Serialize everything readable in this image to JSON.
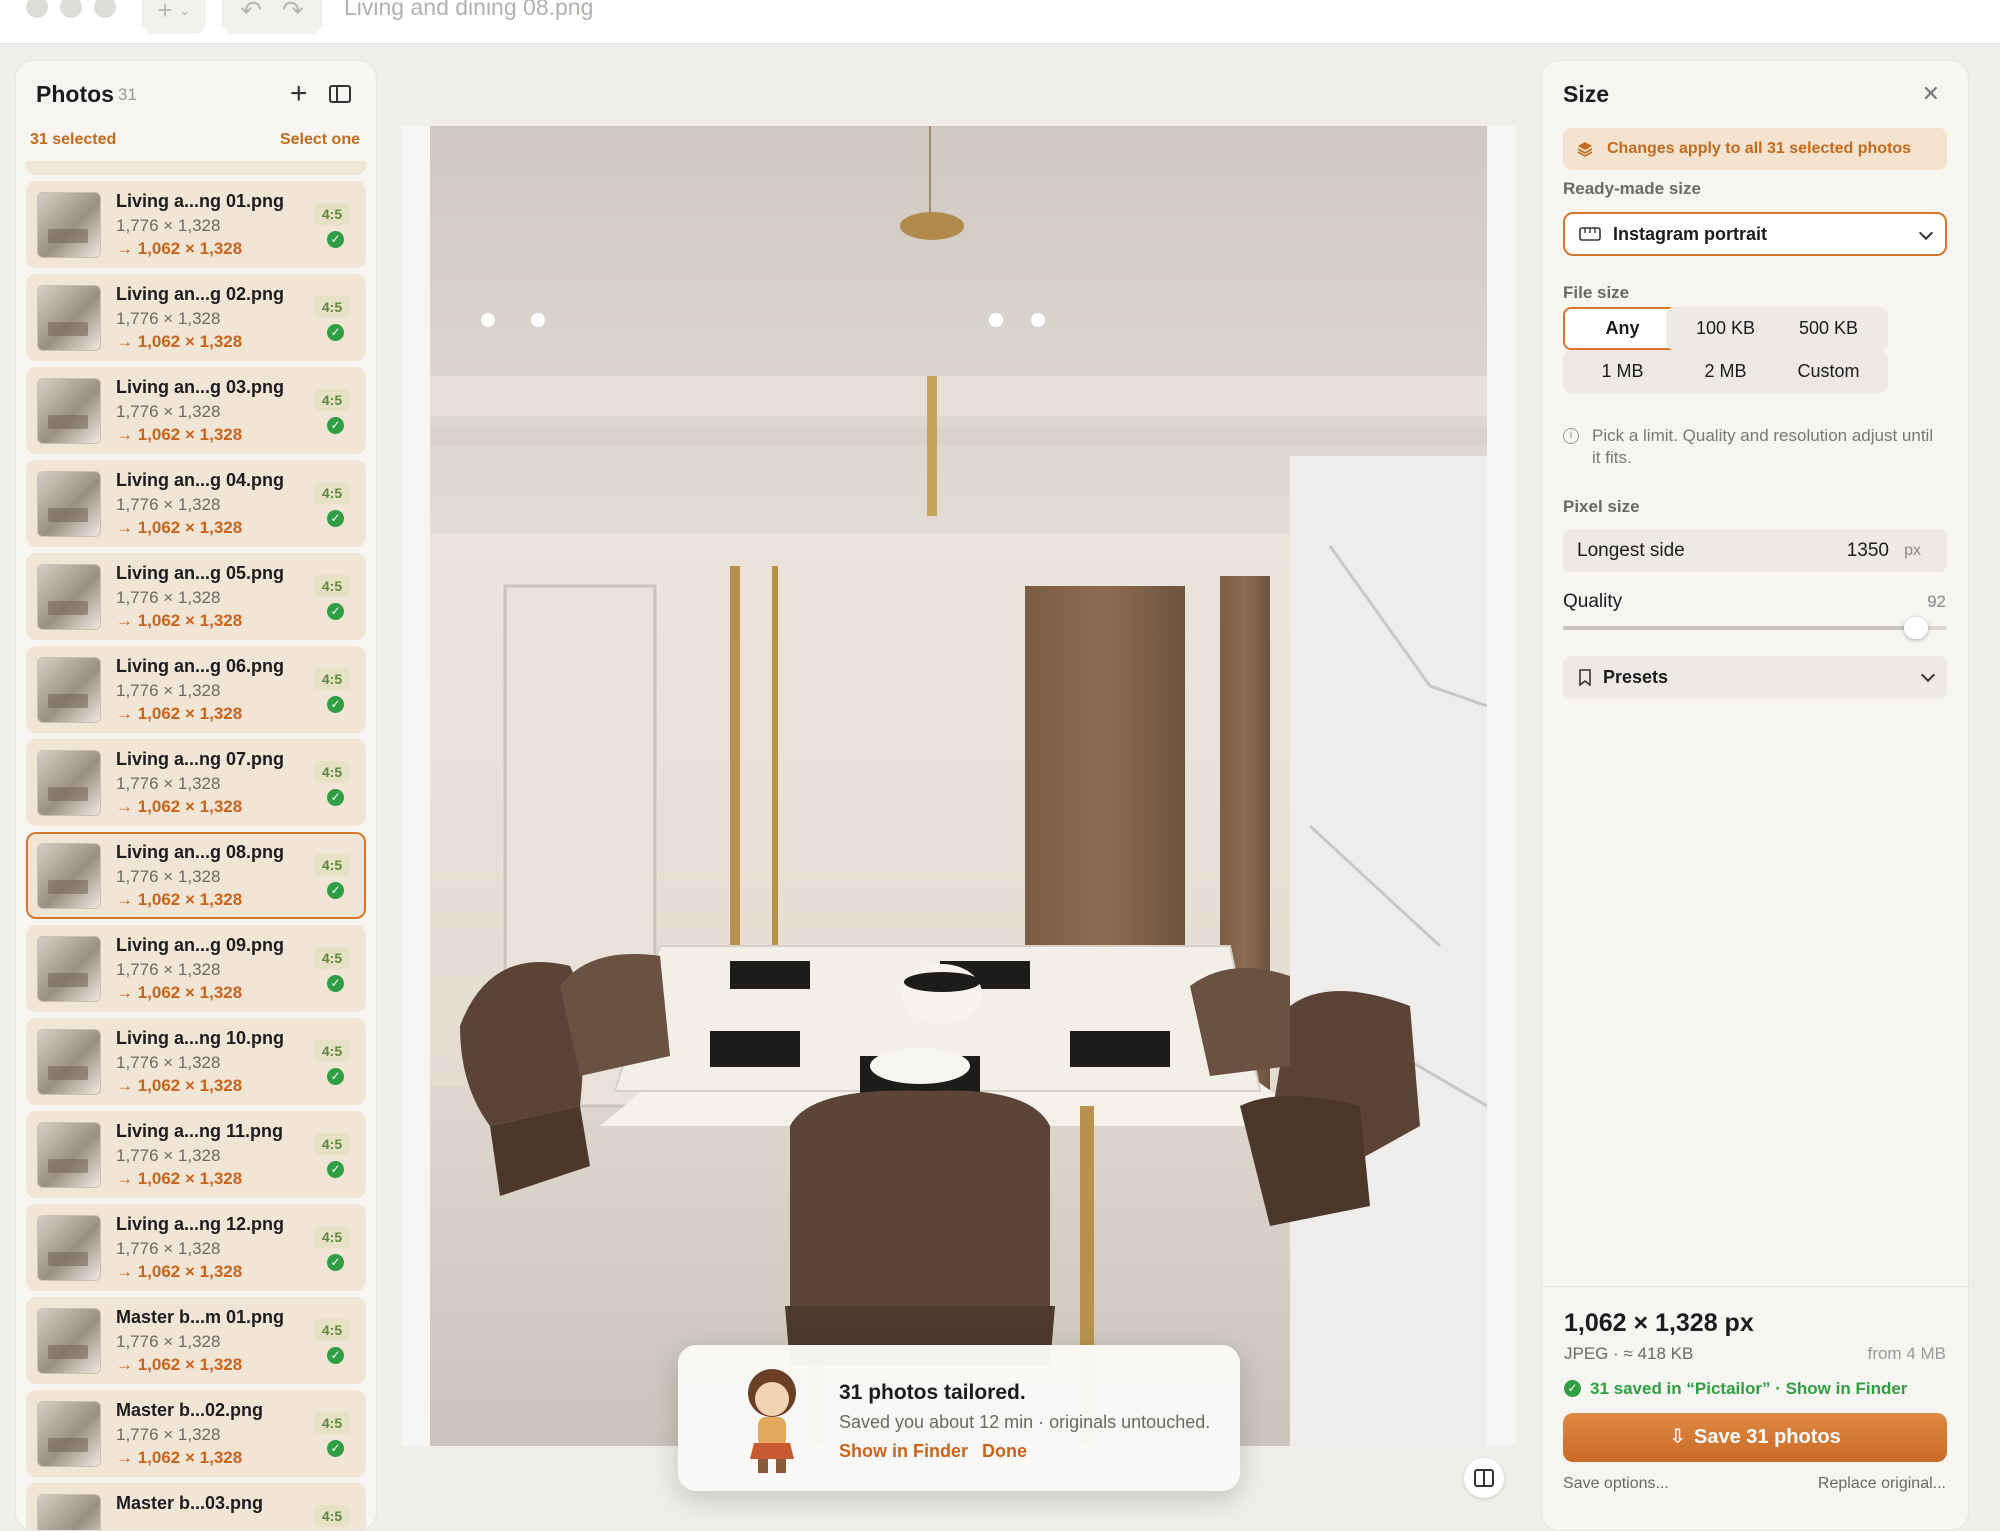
{
  "window": {
    "title": "Living and dining 08.png"
  },
  "sidebar": {
    "title": "Photos",
    "count": "31",
    "selected_text": "31 selected",
    "select_one": "Select one",
    "items": [
      {
        "name": "Living a...ng 01.png",
        "dim": "1,776 × 1,328",
        "new": "→ 1,062 × 1,328",
        "ratio": "4:5",
        "active": false
      },
      {
        "name": "Living an...g 02.png",
        "dim": "1,776 × 1,328",
        "new": "→ 1,062 × 1,328",
        "ratio": "4:5",
        "active": false
      },
      {
        "name": "Living an...g 03.png",
        "dim": "1,776 × 1,328",
        "new": "→ 1,062 × 1,328",
        "ratio": "4:5",
        "active": false
      },
      {
        "name": "Living an...g 04.png",
        "dim": "1,776 × 1,328",
        "new": "→ 1,062 × 1,328",
        "ratio": "4:5",
        "active": false
      },
      {
        "name": "Living an...g 05.png",
        "dim": "1,776 × 1,328",
        "new": "→ 1,062 × 1,328",
        "ratio": "4:5",
        "active": false
      },
      {
        "name": "Living an...g 06.png",
        "dim": "1,776 × 1,328",
        "new": "→ 1,062 × 1,328",
        "ratio": "4:5",
        "active": false
      },
      {
        "name": "Living a...ng 07.png",
        "dim": "1,776 × 1,328",
        "new": "→ 1,062 × 1,328",
        "ratio": "4:5",
        "active": false
      },
      {
        "name": "Living an...g 08.png",
        "dim": "1,776 × 1,328",
        "new": "→ 1,062 × 1,328",
        "ratio": "4:5",
        "active": true
      },
      {
        "name": "Living an...g 09.png",
        "dim": "1,776 × 1,328",
        "new": "→ 1,062 × 1,328",
        "ratio": "4:5",
        "active": false
      },
      {
        "name": "Living a...ng 10.png",
        "dim": "1,776 × 1,328",
        "new": "→ 1,062 × 1,328",
        "ratio": "4:5",
        "active": false
      },
      {
        "name": "Living a...ng 11.png",
        "dim": "1,776 × 1,328",
        "new": "→ 1,062 × 1,328",
        "ratio": "4:5",
        "active": false
      },
      {
        "name": "Living a...ng 12.png",
        "dim": "1,776 × 1,328",
        "new": "→ 1,062 × 1,328",
        "ratio": "4:5",
        "active": false
      },
      {
        "name": "Master b...m 01.png",
        "dim": "1,776 × 1,328",
        "new": "→ 1,062 × 1,328",
        "ratio": "4:5",
        "active": false
      },
      {
        "name": "Master b...02.png",
        "dim": "1,776 × 1,328",
        "new": "→ 1,062 × 1,328",
        "ratio": "4:5",
        "active": false
      },
      {
        "name": "Master b...03.png",
        "dim": "",
        "new": "",
        "ratio": "4:5",
        "active": false
      }
    ]
  },
  "toast": {
    "title": "31 photos tailored.",
    "subtitle": "Saved you about 12 min · originals untouched.",
    "show_in_finder": "Show in Finder",
    "done": "Done"
  },
  "panel": {
    "title": "Size",
    "notice": "Changes apply to all 31 selected photos",
    "ready_label": "Ready-made size",
    "ready_value": "Instagram portrait",
    "file_size_label": "File size",
    "file_sizes": [
      "Any",
      "100 KB",
      "500 KB",
      "1 MB",
      "2 MB",
      "Custom"
    ],
    "file_size_selected": "Any",
    "hint": "Pick a limit. Quality and resolution adjust until it fits.",
    "pixel_label": "Pixel size",
    "longest_label": "Longest side",
    "longest_value": "1350",
    "longest_unit": "px",
    "quality_label": "Quality",
    "quality_value": "92",
    "presets": "Presets",
    "output_dims": "1,062 × 1,328 px",
    "output_meta": "JPEG · ≈ 418 KB",
    "output_from": "from 4 MB",
    "saved_text": "31 saved in “Pictailor” · Show in Finder",
    "save_button": "Save 31 photos",
    "save_options": "Save options...",
    "replace_original": "Replace original..."
  },
  "colors": {
    "accent": "#d9742b",
    "accent_text": "#c8641c",
    "success": "#2f9e44"
  },
  "icons": [
    "plus-icon",
    "undo-icon",
    "redo-icon",
    "sidebar-toggle-icon",
    "close-icon",
    "stack-icon",
    "ruler-icon",
    "chevron-down-icon",
    "info-icon",
    "bookmark-icon",
    "checkmark-icon",
    "save-icon",
    "compare-icon"
  ]
}
